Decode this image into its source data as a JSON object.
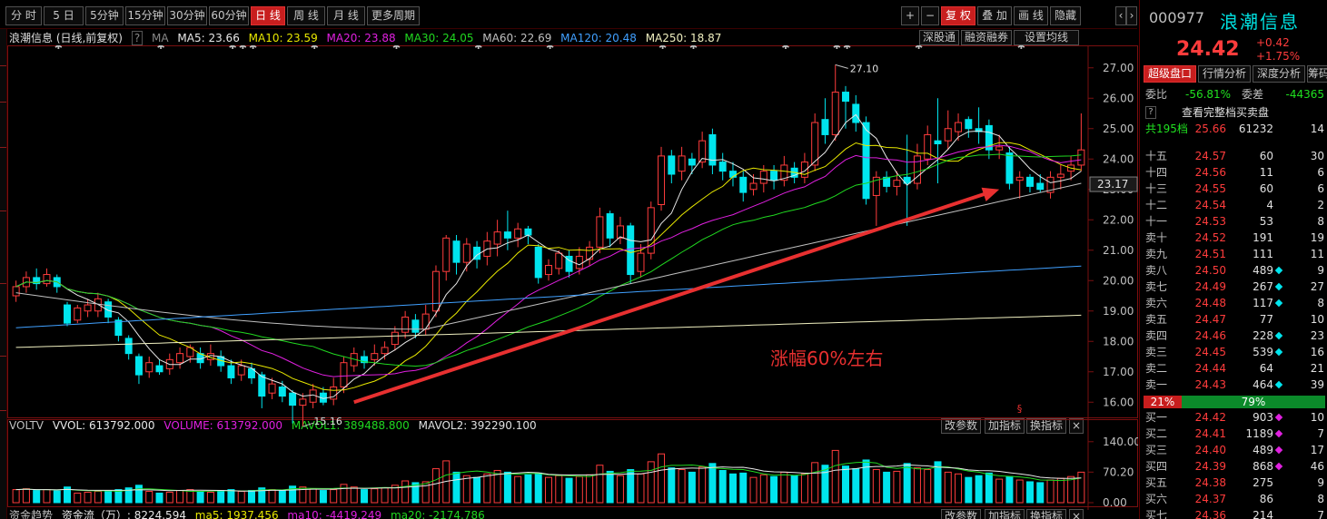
{
  "toolbar": {
    "left_buttons": [
      "分 时",
      "5 日",
      "5分钟",
      "15分钟",
      "30分钟",
      "60分钟",
      "日 线",
      "周 线",
      "月 线",
      "更多周期"
    ],
    "active_index": 6,
    "right_buttons": [
      "+",
      "−",
      "复 权",
      "叠 加",
      "画 线",
      "隐藏"
    ],
    "right_active_index": 2
  },
  "colors": {
    "up": "#ff3c3c",
    "down": "#00e5ee",
    "ma5": "#e8e8e8",
    "ma10": "#e8e800",
    "ma20": "#e020e0",
    "ma30": "#20d820",
    "ma60": "#c0c0c0",
    "ma120": "#40a0ff",
    "ma250": "#f0f0c0",
    "arrow": "#e83030"
  },
  "chart_header": {
    "stock": "浪潮信息 (日线,前复权)",
    "ma_label": "MA",
    "ma5": "MA5: 23.66",
    "ma10": "MA10: 23.59",
    "ma20": "MA20: 23.88",
    "ma30": "MA30: 24.05",
    "ma60": "MA60: 22.69",
    "ma120": "MA120: 20.48",
    "ma250": "MA250: 18.87",
    "buttons": [
      "深股通",
      "融资融券",
      "设置均线"
    ]
  },
  "volume_header": {
    "name": "VOLTV",
    "vvol": "VVOL: 613792.000",
    "volume": "VOLUME: 613792.000",
    "mavol1": "MAVOL1: 389488.800",
    "mavol2": "MAVOL2: 392290.100",
    "buttons": [
      "改参数",
      "加指标",
      "换指标"
    ]
  },
  "fund_header": {
    "name": "资金趋势",
    "flow": "资金流（万）: 8224.594",
    "ma5": "ma5: 1937.456",
    "ma10": "ma10: -4419.249",
    "ma20": "ma20: -2174.786",
    "buttons": [
      "改参数",
      "加指标",
      "换指标"
    ]
  },
  "annotation": {
    "text": "涨幅60%左右",
    "high_label": "27.10",
    "low_label": "15.16",
    "current_price_label": "23.17"
  },
  "chart_data": {
    "type": "candlestick",
    "y_axis_ticks": [
      "27.00",
      "26.00",
      "25.00",
      "24.00",
      "23.00",
      "22.00",
      "21.00",
      "20.00",
      "19.00",
      "18.00",
      "17.00",
      "16.00"
    ],
    "ylim": [
      15.5,
      27.5
    ],
    "volume_ticks": [
      "140.00",
      "70.20",
      "0.00"
    ],
    "volume_max": 150,
    "candles": [
      [
        19.5,
        19.8,
        19.3,
        20.0
      ],
      [
        19.8,
        20.1,
        19.6,
        20.3
      ],
      [
        20.1,
        19.9,
        19.7,
        20.4
      ],
      [
        19.9,
        20.2,
        19.8,
        20.4
      ],
      [
        20.1,
        19.8,
        19.6,
        20.2
      ],
      [
        19.2,
        18.6,
        18.5,
        19.3
      ],
      [
        18.7,
        19.1,
        18.6,
        19.2
      ],
      [
        19.0,
        19.2,
        18.8,
        19.4
      ],
      [
        19.0,
        19.4,
        18.8,
        19.6
      ],
      [
        19.3,
        18.8,
        18.6,
        19.4
      ],
      [
        18.7,
        18.2,
        18.0,
        18.8
      ],
      [
        18.1,
        17.6,
        17.4,
        18.2
      ],
      [
        17.5,
        16.9,
        16.6,
        17.6
      ],
      [
        17.0,
        17.3,
        16.8,
        17.5
      ],
      [
        17.2,
        17.0,
        16.9,
        17.4
      ],
      [
        17.1,
        17.4,
        16.9,
        17.6
      ],
      [
        17.3,
        17.6,
        17.1,
        17.8
      ],
      [
        17.5,
        17.8,
        17.3,
        17.9
      ],
      [
        17.6,
        17.3,
        17.1,
        17.8
      ],
      [
        17.4,
        17.6,
        17.2,
        17.9
      ],
      [
        17.5,
        17.2,
        17.0,
        17.7
      ],
      [
        17.2,
        16.8,
        16.6,
        17.4
      ],
      [
        16.9,
        17.2,
        16.7,
        17.4
      ],
      [
        17.1,
        16.8,
        16.6,
        17.3
      ],
      [
        16.9,
        16.2,
        15.8,
        17.0
      ],
      [
        16.3,
        16.6,
        16.1,
        16.8
      ],
      [
        16.5,
        16.2,
        16.0,
        16.7
      ],
      [
        16.3,
        15.9,
        15.3,
        16.4
      ],
      [
        15.9,
        16.1,
        15.2,
        16.3
      ],
      [
        16.0,
        16.4,
        15.8,
        16.6
      ],
      [
        16.3,
        16.0,
        15.9,
        16.5
      ],
      [
        16.1,
        16.5,
        15.9,
        16.8
      ],
      [
        16.5,
        17.3,
        16.3,
        17.5
      ],
      [
        17.2,
        17.6,
        17.0,
        17.8
      ],
      [
        17.5,
        17.3,
        17.1,
        17.7
      ],
      [
        17.4,
        17.6,
        17.2,
        17.9
      ],
      [
        17.6,
        17.8,
        17.4,
        18.0
      ],
      [
        17.9,
        18.3,
        17.7,
        18.5
      ],
      [
        18.3,
        18.8,
        18.1,
        19.0
      ],
      [
        18.7,
        18.3,
        18.1,
        18.9
      ],
      [
        18.4,
        18.9,
        18.2,
        19.2
      ],
      [
        19.0,
        20.3,
        18.8,
        20.5
      ],
      [
        20.3,
        21.4,
        20.0,
        21.5
      ],
      [
        21.3,
        20.6,
        20.2,
        21.5
      ],
      [
        20.6,
        21.2,
        20.3,
        21.4
      ],
      [
        21.1,
        20.7,
        20.4,
        21.3
      ],
      [
        20.8,
        21.3,
        20.5,
        21.6
      ],
      [
        21.2,
        21.6,
        20.8,
        22.0
      ],
      [
        21.6,
        21.4,
        21.0,
        22.3
      ],
      [
        21.4,
        21.7,
        21.1,
        21.9
      ],
      [
        21.7,
        21.5,
        21.2,
        21.8
      ],
      [
        21.1,
        20.1,
        19.9,
        21.2
      ],
      [
        20.2,
        20.5,
        20.0,
        20.7
      ],
      [
        20.4,
        20.9,
        20.2,
        21.0
      ],
      [
        20.8,
        20.3,
        20.1,
        21.0
      ],
      [
        20.4,
        20.8,
        20.2,
        21.1
      ],
      [
        20.7,
        21.1,
        20.5,
        21.3
      ],
      [
        21.1,
        22.1,
        20.9,
        22.4
      ],
      [
        22.2,
        21.4,
        21.1,
        22.3
      ],
      [
        21.4,
        21.8,
        21.2,
        22.1
      ],
      [
        21.8,
        20.2,
        19.9,
        21.9
      ],
      [
        20.3,
        20.9,
        20.1,
        21.2
      ],
      [
        20.9,
        22.4,
        20.7,
        22.6
      ],
      [
        22.5,
        24.1,
        22.3,
        24.4
      ],
      [
        24.1,
        23.5,
        23.2,
        24.3
      ],
      [
        23.6,
        24.1,
        23.3,
        24.4
      ],
      [
        24.0,
        23.8,
        23.5,
        24.2
      ],
      [
        23.9,
        24.6,
        23.7,
        24.9
      ],
      [
        24.8,
        23.8,
        23.5,
        25.0
      ],
      [
        23.9,
        23.6,
        23.3,
        24.2
      ],
      [
        23.6,
        23.4,
        23.1,
        23.9
      ],
      [
        23.4,
        22.9,
        22.6,
        23.6
      ],
      [
        23.0,
        23.2,
        22.8,
        23.5
      ],
      [
        23.2,
        23.6,
        22.9,
        23.8
      ],
      [
        23.6,
        23.3,
        23.0,
        23.8
      ],
      [
        23.3,
        23.8,
        23.1,
        24.1
      ],
      [
        23.7,
        23.4,
        23.2,
        23.9
      ],
      [
        23.4,
        23.9,
        23.2,
        24.2
      ],
      [
        23.8,
        25.2,
        23.6,
        25.5
      ],
      [
        25.3,
        24.8,
        24.5,
        26.0
      ],
      [
        24.8,
        26.2,
        24.6,
        27.1
      ],
      [
        26.2,
        25.9,
        25.0,
        26.4
      ],
      [
        25.8,
        25.2,
        24.9,
        26.1
      ],
      [
        25.2,
        22.7,
        22.5,
        25.4
      ],
      [
        22.8,
        23.4,
        21.8,
        23.6
      ],
      [
        23.4,
        23.1,
        22.9,
        23.6
      ],
      [
        23.1,
        23.3,
        22.8,
        23.6
      ],
      [
        23.4,
        23.2,
        21.8,
        24.8
      ],
      [
        23.2,
        24.1,
        23.0,
        24.5
      ],
      [
        24.0,
        24.8,
        23.8,
        25.1
      ],
      [
        24.6,
        24.5,
        23.2,
        26.0
      ],
      [
        24.6,
        25.0,
        24.3,
        25.6
      ],
      [
        24.9,
        25.2,
        24.6,
        25.5
      ],
      [
        25.3,
        25.0,
        24.7,
        25.4
      ],
      [
        25.0,
        24.9,
        24.5,
        25.7
      ],
      [
        25.1,
        24.3,
        24.0,
        25.3
      ],
      [
        24.3,
        24.4,
        24.0,
        24.8
      ],
      [
        24.2,
        23.2,
        23.0,
        24.4
      ],
      [
        23.3,
        23.4,
        22.7,
        23.6
      ],
      [
        23.4,
        23.1,
        22.9,
        23.5
      ],
      [
        23.2,
        23.0,
        22.9,
        23.5
      ],
      [
        22.9,
        23.4,
        22.7,
        23.6
      ],
      [
        23.4,
        23.5,
        23.0,
        23.8
      ],
      [
        23.6,
        23.8,
        23.3,
        24.1
      ],
      [
        23.8,
        24.3,
        23.6,
        25.5
      ]
    ],
    "volumes": [
      30,
      32,
      28,
      30,
      27,
      36,
      22,
      24,
      26,
      28,
      30,
      34,
      40,
      26,
      22,
      24,
      28,
      30,
      26,
      24,
      28,
      30,
      26,
      28,
      34,
      30,
      28,
      38,
      36,
      32,
      28,
      30,
      42,
      36,
      30,
      32,
      34,
      40,
      50,
      46,
      48,
      78,
      96,
      70,
      62,
      58,
      66,
      74,
      70,
      60,
      64,
      68,
      58,
      62,
      56,
      60,
      64,
      86,
      72,
      62,
      76,
      66,
      94,
      112,
      80,
      76,
      70,
      82,
      90,
      74,
      66,
      68,
      58,
      64,
      60,
      70,
      62,
      66,
      92,
      86,
      120,
      84,
      78,
      98,
      76,
      70,
      72,
      90,
      80,
      76,
      94,
      70,
      66,
      58,
      62,
      68,
      54,
      60,
      52,
      48,
      46,
      52,
      56,
      60,
      70
    ]
  },
  "right_panel": {
    "code": "000977",
    "name": "浪潮信息",
    "price": "24.42",
    "change": "+0.42",
    "change_pct": "+1.75%",
    "tabs": [
      "超级盘口",
      "行情分析",
      "深度分析",
      "筹码"
    ],
    "weibi_label": "委比",
    "weibi_value": "-56.81%",
    "weicha_label": "委差",
    "weicha_value": "-44365",
    "full_book_label": "查看完整档买卖盘",
    "total_label": "共195档",
    "total_price": "25.66",
    "total_vol": "61232",
    "total_cnt": "14",
    "sell_orders": [
      {
        "label": "十五",
        "price": "24.57",
        "vol": "60",
        "cnt": "30",
        "dot": ""
      },
      {
        "label": "十四",
        "price": "24.56",
        "vol": "11",
        "cnt": "6",
        "dot": ""
      },
      {
        "label": "十三",
        "price": "24.55",
        "vol": "60",
        "cnt": "6",
        "dot": ""
      },
      {
        "label": "十二",
        "price": "24.54",
        "vol": "4",
        "cnt": "2",
        "dot": ""
      },
      {
        "label": "十一",
        "price": "24.53",
        "vol": "53",
        "cnt": "8",
        "dot": ""
      },
      {
        "label": "卖十",
        "price": "24.52",
        "vol": "191",
        "cnt": "19",
        "dot": ""
      },
      {
        "label": "卖九",
        "price": "24.51",
        "vol": "111",
        "cnt": "11",
        "dot": ""
      },
      {
        "label": "卖八",
        "price": "24.50",
        "vol": "489",
        "cnt": "9",
        "dot": "cyan"
      },
      {
        "label": "卖七",
        "price": "24.49",
        "vol": "267",
        "cnt": "27",
        "dot": "cyan"
      },
      {
        "label": "卖六",
        "price": "24.48",
        "vol": "117",
        "cnt": "8",
        "dot": "cyan"
      },
      {
        "label": "卖五",
        "price": "24.47",
        "vol": "77",
        "cnt": "10",
        "dot": ""
      },
      {
        "label": "卖四",
        "price": "24.46",
        "vol": "228",
        "cnt": "23",
        "dot": "cyan"
      },
      {
        "label": "卖三",
        "price": "24.45",
        "vol": "539",
        "cnt": "16",
        "dot": "cyan"
      },
      {
        "label": "卖二",
        "price": "24.44",
        "vol": "64",
        "cnt": "21",
        "dot": ""
      },
      {
        "label": "卖一",
        "price": "24.43",
        "vol": "464",
        "cnt": "39",
        "dot": "cyan"
      }
    ],
    "ratio_left": "21%",
    "ratio_right": "79%",
    "ratio_left_value": 0.21,
    "buy_orders": [
      {
        "label": "买一",
        "price": "24.42",
        "vol": "903",
        "cnt": "10",
        "dot": "magenta"
      },
      {
        "label": "买二",
        "price": "24.41",
        "vol": "1189",
        "cnt": "7",
        "dot": "magenta"
      },
      {
        "label": "买三",
        "price": "24.40",
        "vol": "489",
        "cnt": "17",
        "dot": "magenta"
      },
      {
        "label": "买四",
        "price": "24.39",
        "vol": "868",
        "cnt": "46",
        "dot": "magenta"
      },
      {
        "label": "买五",
        "price": "24.38",
        "vol": "275",
        "cnt": "9",
        "dot": ""
      },
      {
        "label": "买六",
        "price": "24.37",
        "vol": "86",
        "cnt": "8",
        "dot": ""
      },
      {
        "label": "买七",
        "price": "24.36",
        "vol": "214",
        "cnt": "7",
        "dot": ""
      }
    ]
  }
}
